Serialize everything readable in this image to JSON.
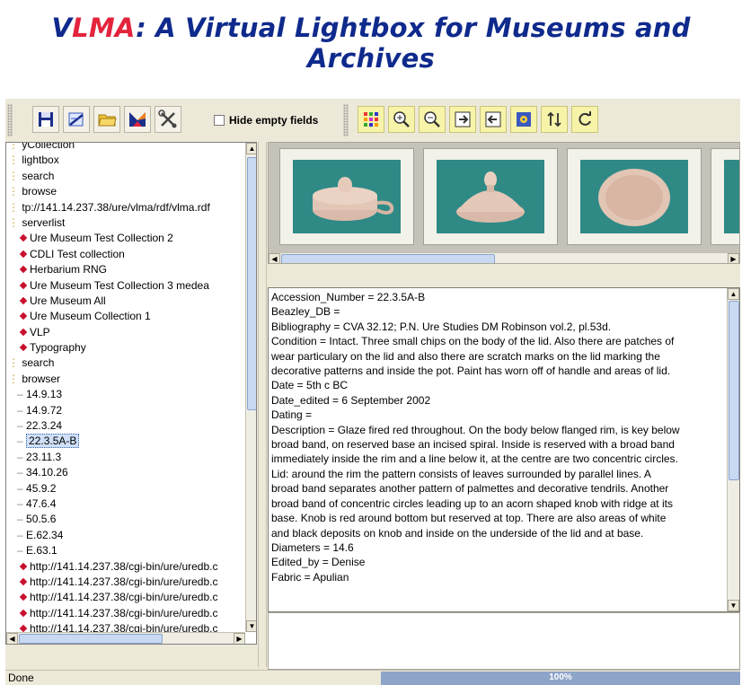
{
  "banner": {
    "v": "V",
    "l": "L",
    "ma": "MA",
    "rest": ": A Virtual Lightbox for Museums and Archives"
  },
  "toolbar": {
    "buttons": [
      "save-icon",
      "edit-icon",
      "open-folder-icon",
      "metadata-icon",
      "tools-icon"
    ],
    "hide_empty_label": "Hide empty fields",
    "hide_empty_checked": false,
    "view_buttons": [
      "grid-icon",
      "zoom-in-icon",
      "zoom-out-icon",
      "forward-icon",
      "back-icon",
      "settings-icon",
      "sort-icon",
      "refresh-icon"
    ]
  },
  "tree": {
    "rows": [
      {
        "text": "yCollection",
        "indent": 0,
        "icon": "none"
      },
      {
        "text": "lightbox",
        "indent": 0,
        "icon": "none"
      },
      {
        "text": "search",
        "indent": 0,
        "icon": "none"
      },
      {
        "text": "browse",
        "indent": 0,
        "icon": "none"
      },
      {
        "text": "tp://141.14.237.38/ure/vlma/rdf/vlma.rdf",
        "indent": 0,
        "icon": "none"
      },
      {
        "text": "serverlist",
        "indent": 0,
        "icon": "none"
      },
      {
        "text": "Ure Museum Test Collection 2",
        "indent": 1,
        "icon": "diamond"
      },
      {
        "text": "CDLI Test collection",
        "indent": 1,
        "icon": "diamond"
      },
      {
        "text": "Herbarium RNG",
        "indent": 1,
        "icon": "diamond"
      },
      {
        "text": "Ure Museum Test Collection 3 medea",
        "indent": 1,
        "icon": "diamond"
      },
      {
        "text": "Ure Museum All",
        "indent": 1,
        "icon": "diamond"
      },
      {
        "text": "Ure Museum Collection 1",
        "indent": 1,
        "icon": "diamond"
      },
      {
        "text": "VLP",
        "indent": 1,
        "icon": "diamond"
      },
      {
        "text": "Typography",
        "indent": 1,
        "icon": "diamond"
      },
      {
        "text": "search",
        "indent": 0,
        "icon": "none"
      },
      {
        "text": "browser",
        "indent": 0,
        "icon": "none"
      },
      {
        "text": "14.9.13",
        "indent": 1,
        "icon": "line"
      },
      {
        "text": "14.9.72",
        "indent": 1,
        "icon": "line"
      },
      {
        "text": "22.3.24",
        "indent": 1,
        "icon": "line"
      },
      {
        "text": "22.3.5A-B",
        "indent": 1,
        "icon": "line",
        "selected": true
      },
      {
        "text": "23.11.3",
        "indent": 1,
        "icon": "line"
      },
      {
        "text": "34.10.26",
        "indent": 1,
        "icon": "line"
      },
      {
        "text": "45.9.2",
        "indent": 1,
        "icon": "line"
      },
      {
        "text": "47.6.4",
        "indent": 1,
        "icon": "line"
      },
      {
        "text": "50.5.6",
        "indent": 1,
        "icon": "line"
      },
      {
        "text": "E.62.34",
        "indent": 1,
        "icon": "line"
      },
      {
        "text": "E.63.1",
        "indent": 1,
        "icon": "line"
      },
      {
        "text": "http://141.14.237.38/cgi-bin/ure/uredb.c",
        "indent": 1,
        "icon": "diamond"
      },
      {
        "text": "http://141.14.237.38/cgi-bin/ure/uredb.c",
        "indent": 1,
        "icon": "diamond"
      },
      {
        "text": "http://141.14.237.38/cgi-bin/ure/uredb.c",
        "indent": 1,
        "icon": "diamond"
      },
      {
        "text": "http://141.14.237.38/cgi-bin/ure/uredb.c",
        "indent": 1,
        "icon": "diamond"
      },
      {
        "text": "http://141.14.237.38/cgi-bin/ure/uredb.c",
        "indent": 1,
        "icon": "diamond"
      }
    ]
  },
  "thumbnails": [
    "lidded-pyxis-side",
    "lidded-pyxis-lid",
    "dish-top",
    "partial-vessel"
  ],
  "details": {
    "lines": [
      "Accession_Number = 22.3.5A-B",
      "Beazley_DB =",
      "Bibliography = CVA 32.12; P.N. Ure Studies DM Robinson vol.2, pl.53d.",
      "Condition = Intact. Three small chips on the body of the lid. Also there are patches of",
      "wear particulary on the lid and also there are scratch marks on the lid marking the",
      "decorative patterns and inside the pot.  Paint has worn off of handle and areas of lid.",
      "Date = 5th c BC",
      "Date_edited = 6 September 2002",
      "Dating =",
      "Description = Glaze fired red throughout. On the body below flanged rim, is key below",
      "broad band, on reserved base an incised spiral. Inside is reserved with a broad band",
      "immediately inside the rim and a line below it, at the centre are two concentric circles.",
      "Lid: around the rim the pattern consists of leaves surrounded by parallel lines. A",
      "broad band separates another pattern of palmettes and decorative tendrils. Another",
      "broad band of concentric circles leading up to an acorn shaped knob with ridge at its",
      "base.  Knob is red around bottom but reserved at top.  There are also areas of white",
      "and black deposits on knob and inside on the underside of the lid and at base.",
      "Diameters = 14.6",
      "Edited_by = Denise",
      "Fabric = Apulian"
    ]
  },
  "status": {
    "text": "Done",
    "progress_label": "100%",
    "progress": 1.0
  }
}
